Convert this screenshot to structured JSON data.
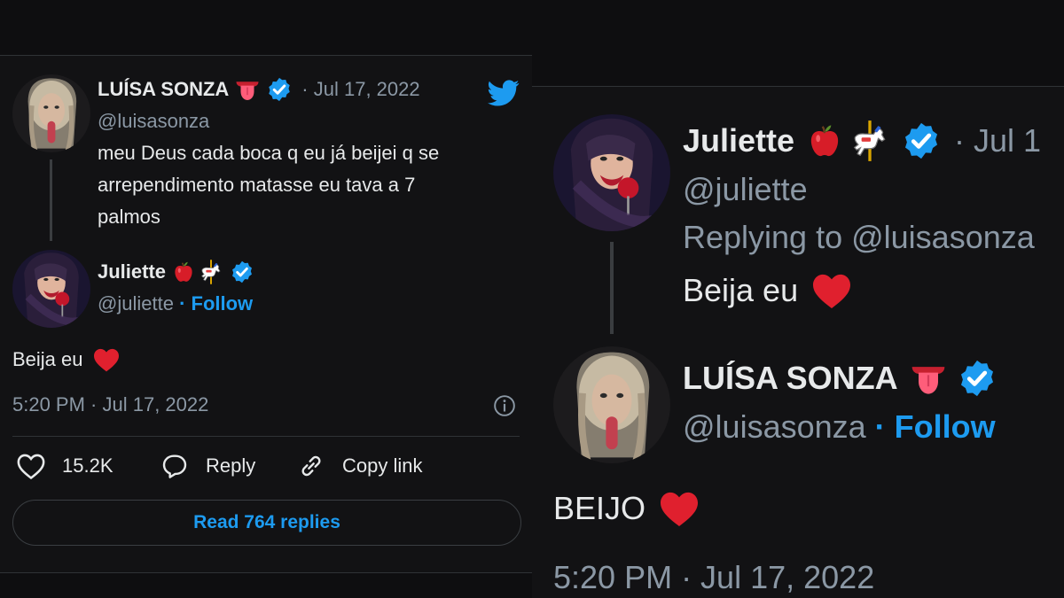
{
  "left": {
    "original": {
      "name": "LUÍSA SONZA",
      "handle": "@luisasonza",
      "date": "· Jul 17, 2022",
      "text_lines": [
        "meu Deus cada boca q eu já beijei q se",
        "arrependimento matasse eu tava a 7",
        "palmos"
      ]
    },
    "reply": {
      "name": "Juliette",
      "handle": "@juliette",
      "follow_label": "· Follow",
      "text": "Beija eu",
      "timestamp": "5:20 PM · Jul 17, 2022"
    },
    "actions": {
      "likes": "15.2K",
      "reply_label": "Reply",
      "copy_label": "Copy link"
    },
    "read_replies": "Read 764 replies"
  },
  "right": {
    "original": {
      "name": "Juliette",
      "handle": "@juliette",
      "date": "· Jul 1",
      "replying_to": "Replying to @luisasonza",
      "text": "Beija eu"
    },
    "reply": {
      "name": "LUÍSA SONZA",
      "handle": "@luisasonza",
      "follow_label": "· Follow",
      "text": "BEIJO",
      "timestamp": "5:20 PM · Jul 17, 2022"
    }
  },
  "colors": {
    "accent": "#1d9bf0",
    "heart": "#e0202e",
    "muted": "#8b98a5"
  },
  "icons": [
    "twitter-bird-icon",
    "verified-badge-icon",
    "tongue-emoji",
    "apple-emoji",
    "carousel-horse-emoji",
    "heart-emoji",
    "like-icon",
    "reply-icon",
    "link-icon",
    "info-icon"
  ]
}
